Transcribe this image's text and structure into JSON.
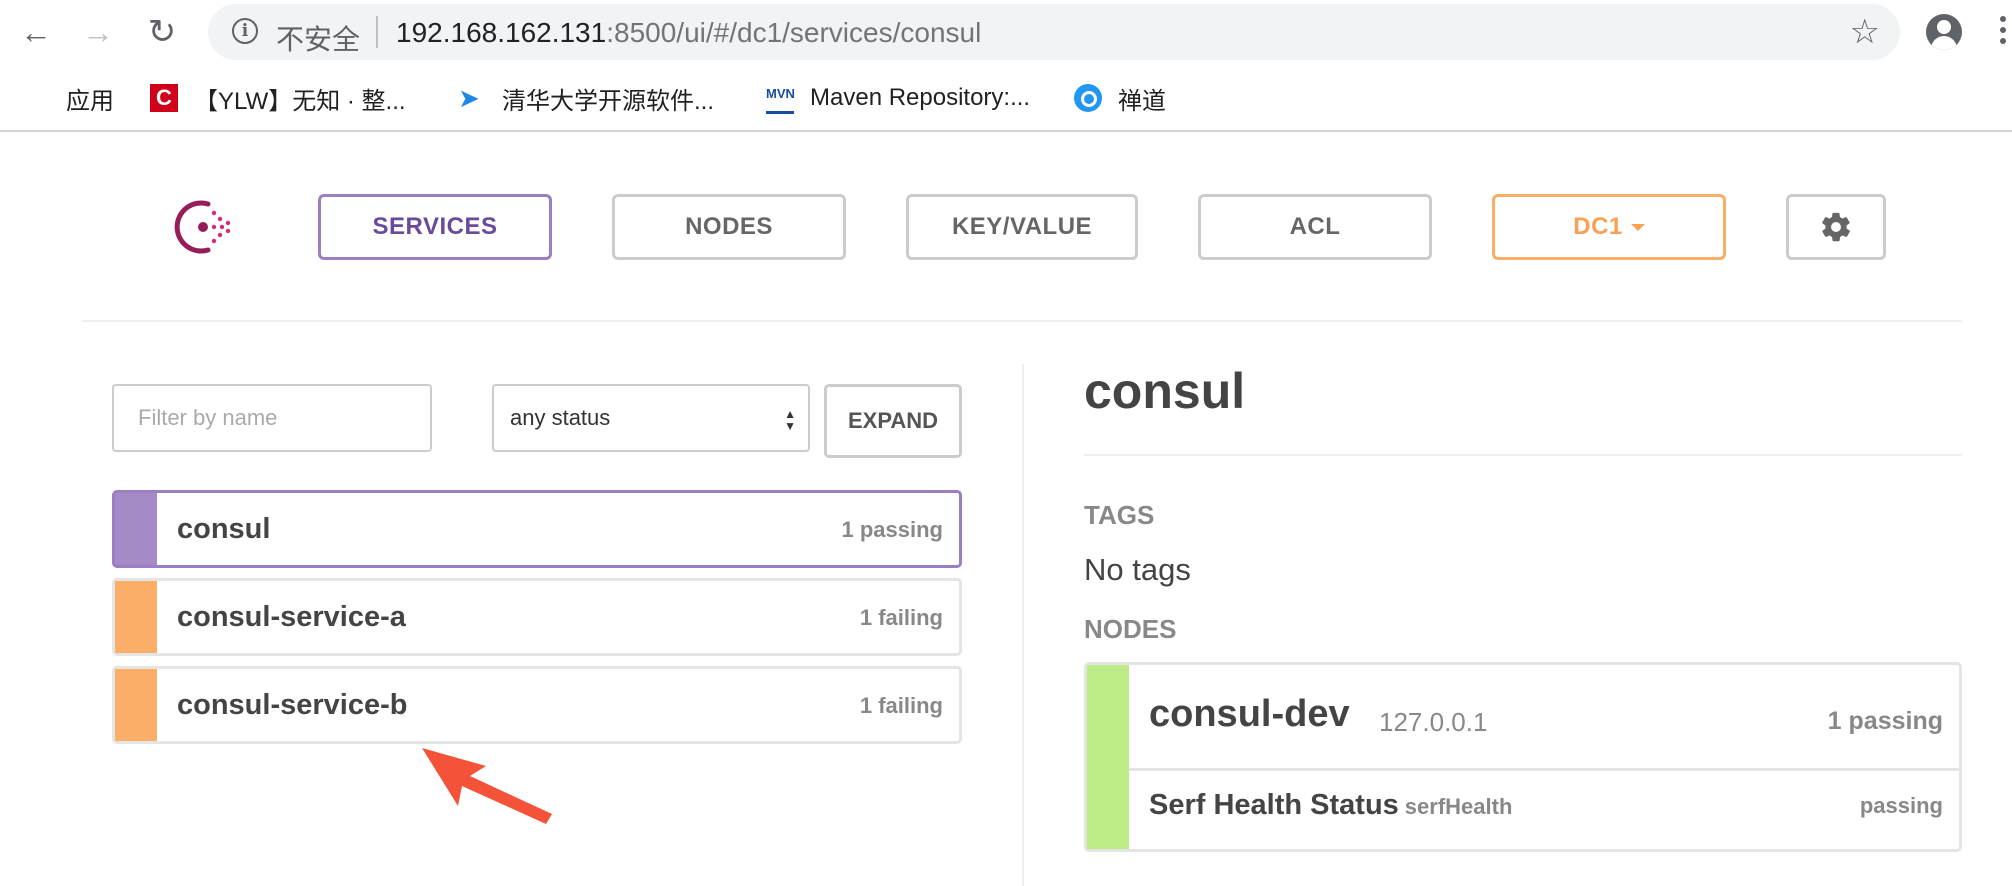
{
  "browser": {
    "insecure_label": "不安全",
    "url_host": "192.168.162.131",
    "url_rest": ":8500/ui/#/dc1/services/consul",
    "bookmarks": [
      {
        "label": "应用",
        "icon": "apps-grid-icon"
      },
      {
        "label": "【YLW】无知 · 整...",
        "icon": "c-logo-icon"
      },
      {
        "label": "清华大学开源软件...",
        "icon": "bird-icon"
      },
      {
        "label": "Maven Repository:...",
        "icon": "mvn-icon"
      },
      {
        "label": "禅道",
        "icon": "zentao-icon"
      }
    ]
  },
  "nav": {
    "services": "SERVICES",
    "nodes": "NODES",
    "keyvalue": "KEY/VALUE",
    "acl": "ACL",
    "dc": "DC1"
  },
  "filter": {
    "placeholder": "Filter by name",
    "status": "any status",
    "expand": "EXPAND"
  },
  "services": [
    {
      "name": "consul",
      "status": "1 passing",
      "color": "#a58bc5",
      "selected": true
    },
    {
      "name": "consul-service-a",
      "status": "1 failing",
      "color": "#fbae68",
      "selected": false
    },
    {
      "name": "consul-service-b",
      "status": "1 failing",
      "color": "#fbae68",
      "selected": false
    }
  ],
  "detail": {
    "title": "consul",
    "tags_label": "TAGS",
    "tags_value": "No tags",
    "nodes_label": "NODES",
    "node": {
      "name": "consul-dev",
      "ip": "127.0.0.1",
      "status": "1 passing",
      "check_name": "Serf Health Status",
      "check_id": "serfHealth",
      "check_status": "passing",
      "color": "#bdeb86"
    }
  },
  "colors": {
    "accent_purple": "#694a9c",
    "dc_orange": "#f9a055",
    "passing_green": "#bdeb86",
    "failing_orange": "#fbae68",
    "annotation_arrow": "#f5523a"
  }
}
